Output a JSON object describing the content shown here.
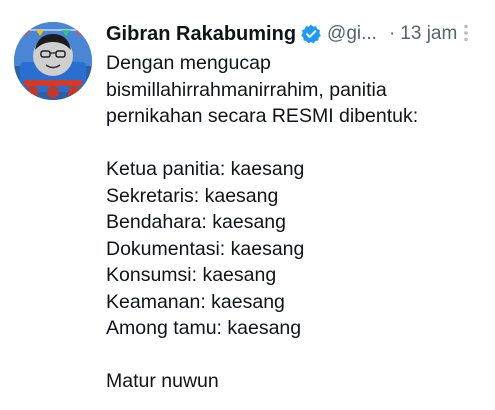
{
  "tweet": {
    "display_name": "Gibran Rakabuming",
    "handle": "@gi...",
    "separator": "·",
    "time": "13 jam",
    "verified_color": "#1d9bf0",
    "avatar_icon": "profile-avatar",
    "more_icon": "vertical-ellipsis-icon",
    "lines": [
      "Dengan mengucap",
      "bismillahirrahmanirrahim, panitia",
      "pernikahan secara RESMI dibentuk:",
      "",
      "Ketua panitia: kaesang",
      "Sekretaris: kaesang",
      "Bendahara: kaesang",
      "Dokumentasi: kaesang",
      "Konsumsi: kaesang",
      "Keamanan: kaesang",
      "Among tamu: kaesang",
      "",
      "Matur nuwun"
    ]
  }
}
